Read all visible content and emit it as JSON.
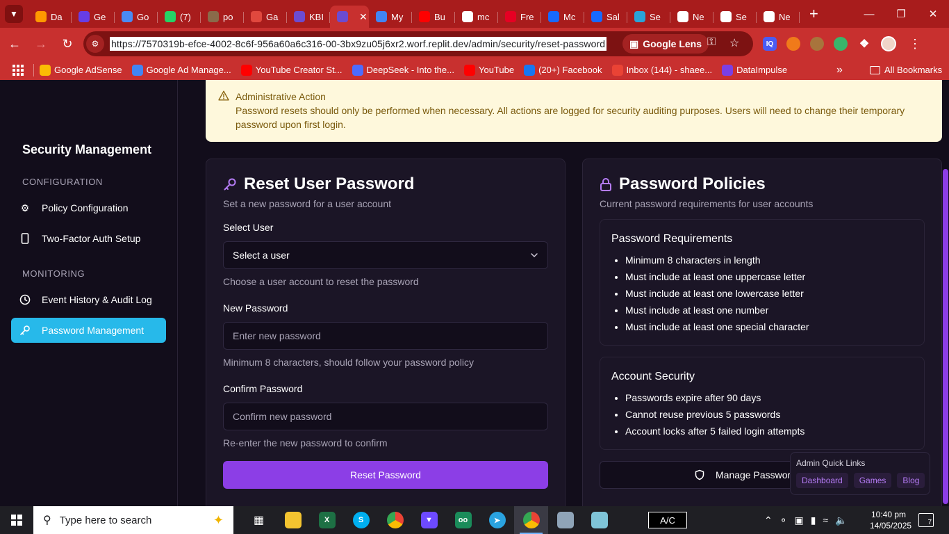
{
  "browser": {
    "tabs": [
      {
        "label": "Da",
        "icon": "amazon-icon",
        "color": "#ff9900"
      },
      {
        "label": "Ge",
        "icon": "hostinger-icon",
        "color": "#673de6"
      },
      {
        "label": "Go",
        "icon": "shield-icon",
        "color": "#4a8af4"
      },
      {
        "label": "(7)",
        "icon": "whatsapp-icon",
        "color": "#25d366"
      },
      {
        "label": "po",
        "icon": "avatar-icon",
        "color": "#8a6a4a"
      },
      {
        "label": "Ga",
        "icon": "puzzle-icon",
        "color": "#e0483e"
      },
      {
        "label": "KBI",
        "icon": "replit-icon",
        "color": "#6c4bd1"
      },
      {
        "label": "",
        "icon": "replit-icon",
        "color": "#6c4bd1"
      },
      {
        "label": "My",
        "icon": "link-icon",
        "color": "#4285f4"
      },
      {
        "label": "Bu",
        "icon": "youtube-icon",
        "color": "#ff0000"
      },
      {
        "label": "mc",
        "icon": "google-icon",
        "color": "#ffffff"
      },
      {
        "label": "Fre",
        "icon": "pinterest-icon",
        "color": "#e60023"
      },
      {
        "label": "Mc",
        "icon": "behance-icon",
        "color": "#1769ff"
      },
      {
        "label": "Sal",
        "icon": "behance-icon",
        "color": "#1769ff"
      },
      {
        "label": "Se",
        "icon": "grid-icon",
        "color": "#2aa4d8"
      },
      {
        "label": "Ne",
        "icon": "chrome-icon",
        "color": "#ffffff"
      },
      {
        "label": "Se",
        "icon": "gear-icon",
        "color": "#ffffff"
      },
      {
        "label": "Ne",
        "icon": "chrome-icon",
        "color": "#ffffff"
      }
    ],
    "url": "https://7570319b-efce-4002-8c6f-956a60a6c316-00-3bx9zu05j6xr2.worf.replit.dev/admin/security/reset-password",
    "lens_label": "Google Lens",
    "bookmarks": [
      {
        "label": "Google AdSense",
        "color": "#fbbc04"
      },
      {
        "label": "Google Ad Manage...",
        "color": "#4285f4"
      },
      {
        "label": "YouTube Creator St...",
        "color": "#ff0000"
      },
      {
        "label": "DeepSeek - Into the...",
        "color": "#4d6bfe"
      },
      {
        "label": "YouTube",
        "color": "#ff0000"
      },
      {
        "label": "(20+) Facebook",
        "color": "#1877f2"
      },
      {
        "label": "Inbox (144) - shaee...",
        "color": "#ea4335"
      },
      {
        "label": "DataImpulse",
        "color": "#7b3fe4"
      }
    ],
    "all_bookmarks": "All Bookmarks"
  },
  "sidebar": {
    "title": "Security Management",
    "sections": [
      {
        "label": "CONFIGURATION"
      },
      {
        "label": "MONITORING"
      }
    ],
    "items": [
      {
        "label": "Policy Configuration",
        "icon": "gear-icon"
      },
      {
        "label": "Two-Factor Auth Setup",
        "icon": "smartphone-icon"
      },
      {
        "label": "Event History & Audit Log",
        "icon": "clock-icon"
      },
      {
        "label": "Password Management",
        "icon": "key-icon",
        "active": true
      }
    ]
  },
  "alert": {
    "title": "Administrative Action",
    "text": "Password resets should only be performed when necessary. All actions are logged for security auditing purposes. Users will need to change their temporary password upon first login."
  },
  "reset_card": {
    "title": "Reset User Password",
    "subtitle": "Set a new password for a user account",
    "select_label": "Select User",
    "select_value": "Select a user",
    "select_hint": "Choose a user account to reset the password",
    "new_label": "New Password",
    "new_placeholder": "Enter new password",
    "new_hint": "Minimum 8 characters, should follow your password policy",
    "confirm_label": "Confirm Password",
    "confirm_placeholder": "Confirm new password",
    "confirm_hint": "Re-enter the new password to confirm",
    "button": "Reset Password"
  },
  "policies_card": {
    "title": "Password Policies",
    "subtitle": "Current password requirements for user accounts",
    "requirements": {
      "title": "Password Requirements",
      "items": [
        "Minimum 8 characters in length",
        "Must include at least one uppercase letter",
        "Must include at least one lowercase letter",
        "Must include at least one number",
        "Must include at least one special character"
      ]
    },
    "security": {
      "title": "Account Security",
      "items": [
        "Passwords expire after 90 days",
        "Cannot reuse previous 5 passwords",
        "Account locks after 5 failed login attempts"
      ]
    },
    "manage_button": "Manage Passwor"
  },
  "quick_links": {
    "title": "Admin Quick Links",
    "links": [
      "Dashboard",
      "Games",
      "Blog"
    ]
  },
  "taskbar": {
    "search_placeholder": "Type here to search",
    "ac_label": "A/C",
    "time": "10:40 pm",
    "date": "14/05/2025",
    "notifications": "7"
  },
  "colors": {
    "accent_purple": "#8c3ee6",
    "active_item": "#27b9ea",
    "browser_red": "#c8302f",
    "alert_bg": "#fef8dc"
  }
}
